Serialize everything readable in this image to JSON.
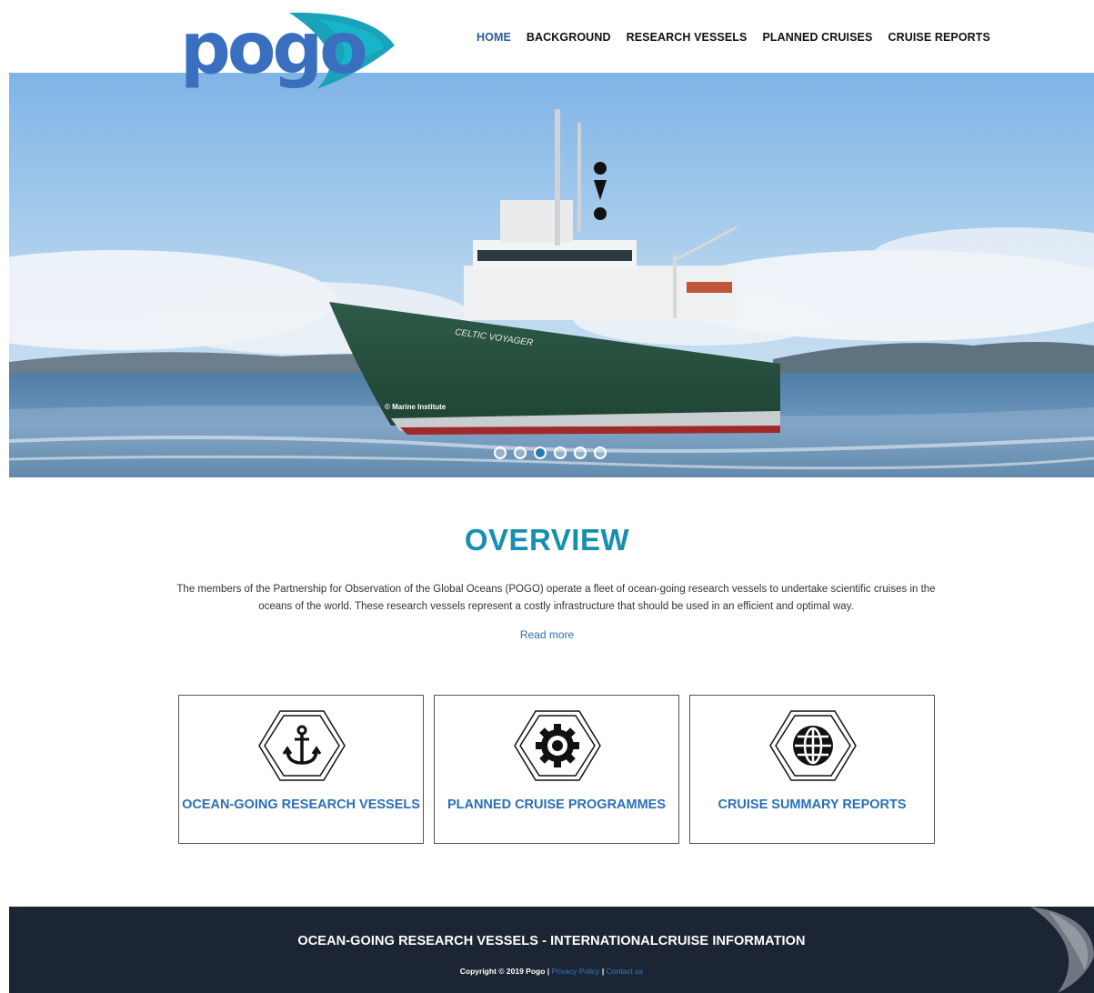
{
  "header": {
    "logo_text": "pogo",
    "nav": [
      {
        "label": "HOME",
        "active": true
      },
      {
        "label": "BACKGROUND",
        "active": false
      },
      {
        "label": "RESEARCH VESSELS",
        "active": false
      },
      {
        "label": "PLANNED CRUISES",
        "active": false
      },
      {
        "label": "CRUISE REPORTS",
        "active": false
      }
    ]
  },
  "hero": {
    "ship_name": "CELTIC VOYAGER",
    "credit": "© Marine Institute",
    "slide_count": 6,
    "active_slide": 3
  },
  "overview": {
    "title": "OVERVIEW",
    "text": "The members of the Partnership for Observation of the Global Oceans (POGO) operate a fleet of ocean-going research vessels to undertake scientific cruises in the oceans of the world. These research vessels represent a costly infrastructure that should be used in an efficient and optimal way.",
    "read_more": "Read more"
  },
  "cards": [
    {
      "label": "OCEAN-GOING RESEARCH VESSELS",
      "icon": "anchor-icon"
    },
    {
      "label": "PLANNED CRUISE PROGRAMMES",
      "icon": "gear-icon"
    },
    {
      "label": "CRUISE SUMMARY REPORTS",
      "icon": "globe-icon"
    }
  ],
  "footer": {
    "title": "OCEAN-GOING RESEARCH VESSELS - INTERNATIONALCRUISE INFORMATION",
    "copyright": "Copyright © 2019 Pogo |",
    "privacy": "Privacy Policy",
    "separator": "|",
    "contact": "Contact us"
  },
  "colors": {
    "accent": "#1690b0",
    "link": "#2a6fb5",
    "nav_active": "#2a5d9f",
    "footer_bg": "#1c2533",
    "logo_blue": "#3a6fc0",
    "logo_teal": "#1aa3b8"
  }
}
